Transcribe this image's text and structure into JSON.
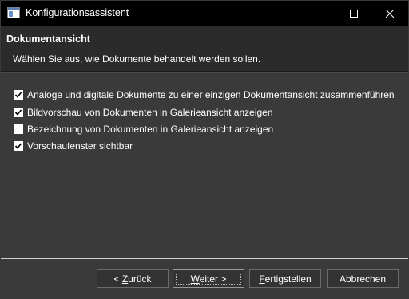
{
  "window": {
    "title": "Konfigurationsassistent",
    "controls": {
      "minimize": "minimize",
      "maximize": "maximize",
      "close": "close"
    }
  },
  "header": {
    "title": "Dokumentansicht",
    "subtitle": "Wählen Sie aus, wie Dokumente behandelt werden sollen."
  },
  "options": [
    {
      "label": "Analoge und digitale Dokumente zu einer einzigen Dokumentansicht zusammenführen",
      "checked": true
    },
    {
      "label": "Bildvorschau von Dokumenten in Galerieansicht anzeigen",
      "checked": true
    },
    {
      "label": "Bezeichnung von Dokumenten in Galerieansicht anzeigen",
      "checked": false
    },
    {
      "label": "Vorschaufenster sichtbar",
      "checked": true
    }
  ],
  "buttons": {
    "back": {
      "prefix": "< ",
      "mnemonic": "Z",
      "rest": "urück"
    },
    "next": {
      "mnemonic": "W",
      "rest": "eiter >"
    },
    "finish": {
      "mnemonic": "F",
      "rest": "ertigstellen"
    },
    "cancel": {
      "label": "Abbrechen"
    }
  },
  "colors": {
    "titlebar": "#000000",
    "panel": "#3a3a3a",
    "header": "#2b2b2b",
    "text": "#ffffff"
  }
}
